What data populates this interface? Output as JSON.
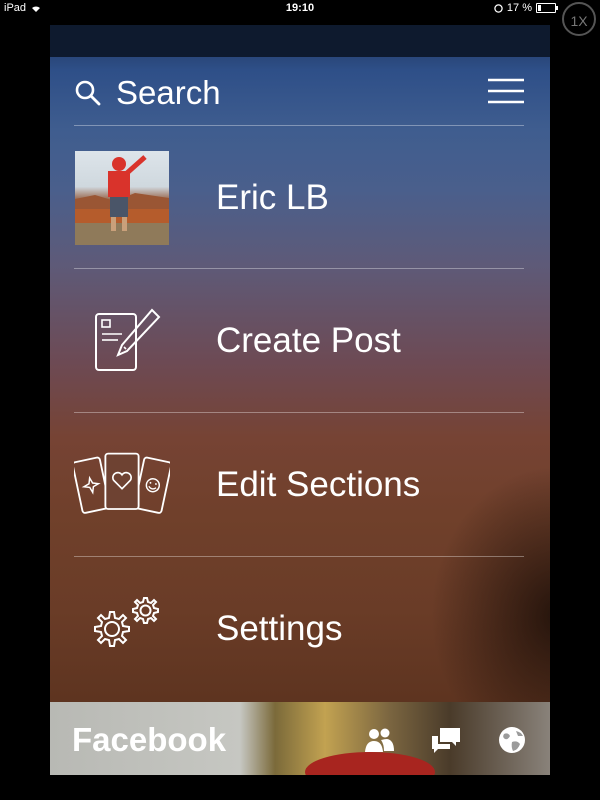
{
  "status_bar": {
    "device": "iPad",
    "time": "19:10",
    "battery": "17 %",
    "zoom": "1X"
  },
  "search": {
    "label": "Search"
  },
  "menu": {
    "items": [
      {
        "label": "Eric LB",
        "icon": "profile-photo"
      },
      {
        "label": "Create Post",
        "icon": "compose-icon"
      },
      {
        "label": "Edit Sections",
        "icon": "cards-icon"
      },
      {
        "label": "Settings",
        "icon": "gears-icon"
      }
    ]
  },
  "tabbar": {
    "app_name": "Facebook",
    "icons": [
      "friends-icon",
      "messages-icon",
      "globe-icon"
    ]
  }
}
